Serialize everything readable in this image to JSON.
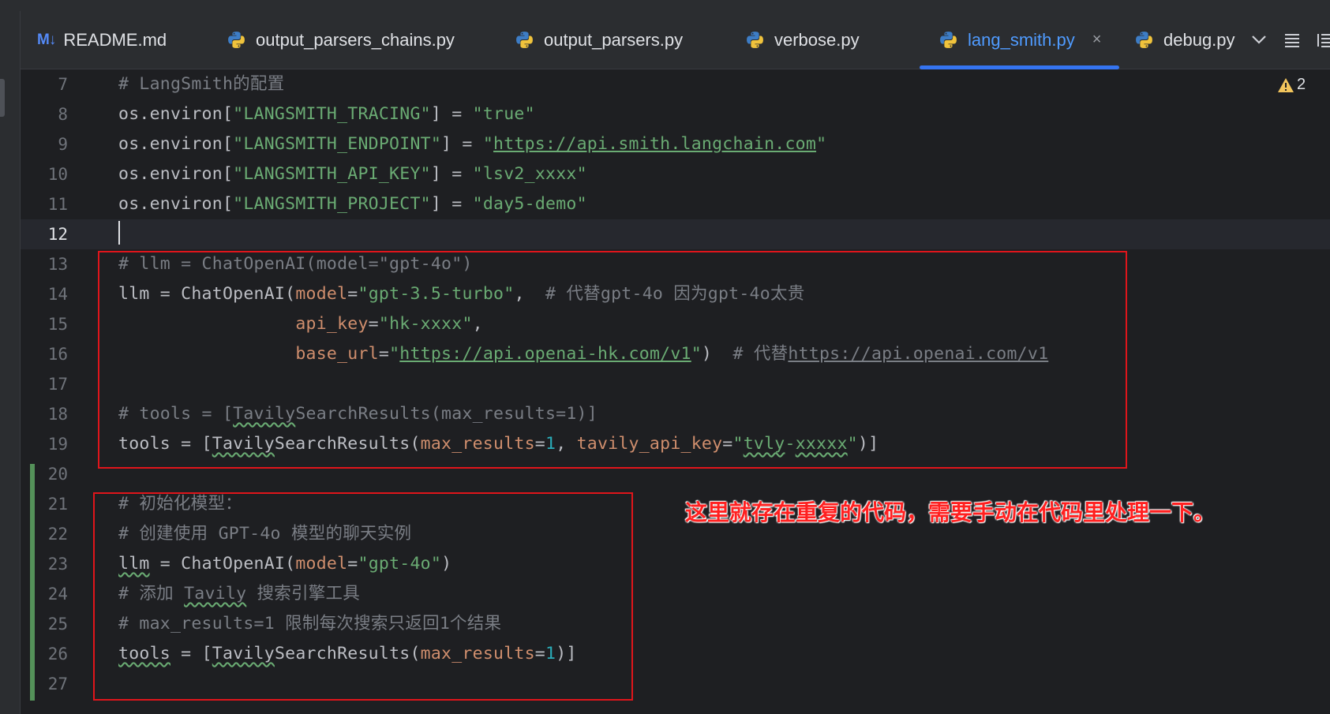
{
  "tabs": [
    {
      "label": "README.md",
      "icon": "markdown-icon",
      "icon_text": "M↓"
    },
    {
      "label": "output_parsers_chains.py",
      "icon": "python-icon"
    },
    {
      "label": "output_parsers.py",
      "icon": "python-icon"
    },
    {
      "label": "verbose.py",
      "icon": "python-icon"
    },
    {
      "label": "lang_smith.py",
      "icon": "python-icon",
      "active": true,
      "close": "×"
    },
    {
      "label": "debug.py",
      "icon": "python-icon"
    }
  ],
  "tab_tools": {
    "more_tabs": "chevron-down-icon",
    "structure": "list-icon",
    "reader_mode": "reader-mode-icon"
  },
  "editor": {
    "warning_count": "2",
    "current_line": 12,
    "lines": [
      {
        "n": "7",
        "code": "# LangSmith的配置"
      },
      {
        "n": "8",
        "code": "os.environ[\"LANGSMITH_TRACING\"] = \"true\""
      },
      {
        "n": "9",
        "code": "os.environ[\"LANGSMITH_ENDPOINT\"] = \"https://api.smith.langchain.com\""
      },
      {
        "n": "10",
        "code": "os.environ[\"LANGSMITH_API_KEY\"] = \"lsv2_xxxx\""
      },
      {
        "n": "11",
        "code": "os.environ[\"LANGSMITH_PROJECT\"] = \"day5-demo\""
      },
      {
        "n": "12",
        "code": ""
      },
      {
        "n": "13",
        "code": "# llm = ChatOpenAI(model=\"gpt-4o\")"
      },
      {
        "n": "14",
        "code": "llm = ChatOpenAI(model=\"gpt-3.5-turbo\",  # 代替gpt-4o 因为gpt-4o太贵"
      },
      {
        "n": "15",
        "code": "                 api_key=\"hk-xxxx\","
      },
      {
        "n": "16",
        "code": "                 base_url=\"https://api.openai-hk.com/v1\")  # 代替https://api.openai.com/v1"
      },
      {
        "n": "17",
        "code": ""
      },
      {
        "n": "18",
        "code": "# tools = [TavilySearchResults(max_results=1)]"
      },
      {
        "n": "19",
        "code": "tools = [TavilySearchResults(max_results=1, tavily_api_key=\"tvly-xxxxx\")]"
      },
      {
        "n": "20",
        "code": ""
      },
      {
        "n": "21",
        "code": "# 初始化模型："
      },
      {
        "n": "22",
        "code": "# 创建使用 GPT-4o 模型的聊天实例"
      },
      {
        "n": "23",
        "code": "llm = ChatOpenAI(model=\"gpt-4o\")"
      },
      {
        "n": "24",
        "code": "# 添加 Tavily 搜索引擎工具"
      },
      {
        "n": "25",
        "code": "# max_results=1 限制每次搜索只返回1个结果"
      },
      {
        "n": "26",
        "code": "tools = [TavilySearchResults(max_results=1)]"
      },
      {
        "n": "27",
        "code": ""
      }
    ]
  },
  "annotation": "这里就存在重复的代码，需要手动在代码里处理一下。",
  "colors": {
    "background": "#1e1f22",
    "comment": "#7a7e85",
    "string": "#6aab73",
    "param": "#cf8e6d",
    "number": "#2aacb8",
    "active_tab": "#3574f0",
    "annotation_red": "#ff2020",
    "change_bar": "#549159"
  }
}
